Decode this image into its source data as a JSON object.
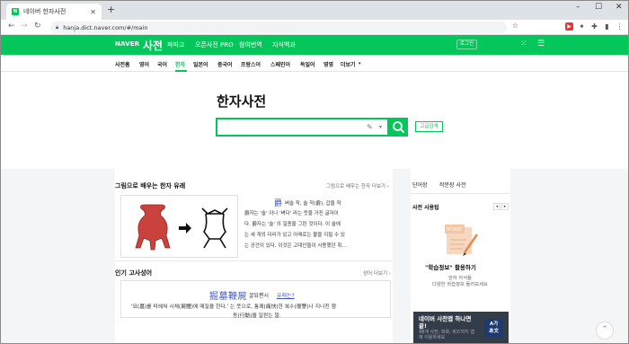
{
  "browser": {
    "tab_title": "네이버 한자사전",
    "tab_favicon": "N",
    "new_tab": "+",
    "url": "hanja.dict.naver.com/#/main"
  },
  "header": {
    "logo": "NAVER",
    "service": "사전",
    "nav": [
      "파파고",
      "오픈사전 PRO",
      "참여번역",
      "지식백과"
    ],
    "login": "로그인"
  },
  "lnb": {
    "items": [
      "사전홈",
      "영어",
      "국어",
      "한자",
      "일본어",
      "중국어",
      "프랑스어",
      "스페인어",
      "독일어",
      "영영",
      "더보기"
    ],
    "active": "한자"
  },
  "search": {
    "title": "한자사전",
    "advanced": "고급검색"
  },
  "learn": {
    "title": "그림으로 배우는 한자 유래",
    "more": "그림으로 배우는 한자 더보기",
    "hanja": "爵",
    "reading": "벼슬 작, 술 작(爵), 갑을 작",
    "lines": [
      "爵자는 '술' 이나 '벼다' 라는 뜻을 가진 글자이",
      "다. 爵자는 '술' 의 일종을 그린 것이다. 이 술에",
      "는 세 개의 다리가 있고 아래로는 불을 지필 수 있",
      "는 공간이 있다. 이것은 고대인들이 사용했던 취..."
    ]
  },
  "idiom": {
    "title": "인기 고사성어",
    "more": "성어 더보기",
    "hanja": "掘墓鞭屍",
    "reading": "굴묘편시",
    "link": "유래는?",
    "lines": [
      "'묘(墓)를 파헤쳐 시체(屍體)에 매질을 한다.' 는 뜻으로, 통쾌(痛快)한 복수(復讐)나 지나친 행",
      "동(行動)을 일컫는 말."
    ]
  },
  "right": {
    "tabs": [
      "단어장",
      "작문장 사전"
    ],
    "tips_title": "사전 사용팁",
    "study_tag": "STUDY",
    "tip_title": "\"학습정보\" 활용하기",
    "tip_desc": [
      "한자 자석들",
      "다양한 학습정보 둘러보세요"
    ],
    "app_title": "네이버 사전앱 하나면 끝!",
    "app_desc": "48개 사전, 회화, 퀴즈까지 앱에 이용하세요",
    "app_icon": [
      "A가",
      "あ文"
    ]
  },
  "colors": {
    "naver_green": "#03c75a",
    "hanja_blue": "#3f57b5"
  }
}
